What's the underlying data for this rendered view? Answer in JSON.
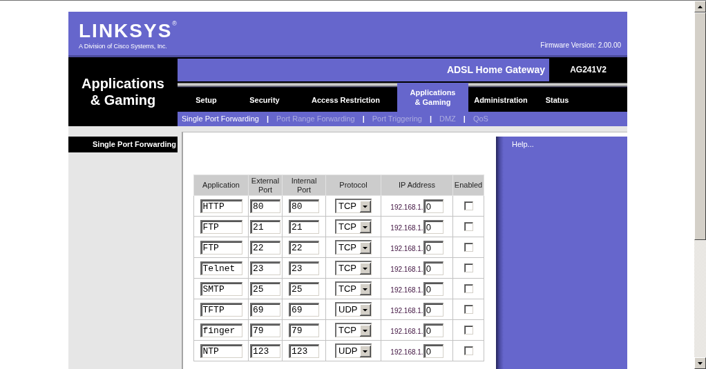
{
  "header": {
    "logo": "LINKSYS$^{®}$",
    "tagline": "A Division of Cisco Systems, Inc.",
    "firmware": "Firmware Version: 2.00.00"
  },
  "section_title": "Applications & Gaming",
  "product": {
    "name": "ADSL Home Gateway",
    "model": "AG241V2"
  },
  "tabs": [
    {
      "label": "Setup",
      "selected": false
    },
    {
      "label": "Security",
      "selected": false
    },
    {
      "label": "Access Restriction",
      "selected": false
    },
    {
      "label": "Applications & Gaming",
      "selected": true
    },
    {
      "label": "Administration",
      "selected": false
    },
    {
      "label": "Status",
      "selected": false
    }
  ],
  "subnav": [
    {
      "kind": "link",
      "label": "Single Port Forwarding",
      "selected": true
    },
    {
      "kind": "separator",
      "label": "|"
    },
    {
      "kind": "link",
      "label": "Port Range Forwarding",
      "selected": false
    },
    {
      "kind": "separator",
      "label": "|"
    },
    {
      "kind": "link",
      "label": "Port Triggering",
      "selected": false
    },
    {
      "kind": "separator",
      "label": "|"
    },
    {
      "kind": "link",
      "label": "DMZ",
      "selected": false
    },
    {
      "kind": "separator",
      "label": "|"
    },
    {
      "kind": "link",
      "label": "QoS",
      "selected": false
    }
  ],
  "sidebar": {
    "heading": "Single Port Forwarding"
  },
  "table": {
    "columns": [
      "Application",
      "External Port",
      "Internal Port",
      "Protocol",
      "IP Address",
      "Enabled"
    ],
    "rows": [
      {
        "application": "HTTP",
        "external_port": "80",
        "internal_port": "80",
        "protocol": "TCP",
        "ip_prefix": "192.168.1.",
        "ip_last": "0",
        "enabled": false
      },
      {
        "application": "FTP",
        "external_port": "21",
        "internal_port": "21",
        "protocol": "TCP",
        "ip_prefix": "192.168.1.",
        "ip_last": "0",
        "enabled": false
      },
      {
        "application": "FTP",
        "external_port": "22",
        "internal_port": "22",
        "protocol": "TCP",
        "ip_prefix": "192.168.1.",
        "ip_last": "0",
        "enabled": false
      },
      {
        "application": "Telnet",
        "external_port": "23",
        "internal_port": "23",
        "protocol": "TCP",
        "ip_prefix": "192.168.1.",
        "ip_last": "0",
        "enabled": false
      },
      {
        "application": "SMTP",
        "external_port": "25",
        "internal_port": "25",
        "protocol": "TCP",
        "ip_prefix": "192.168.1.",
        "ip_last": "0",
        "enabled": false
      },
      {
        "application": "TFTP",
        "external_port": "69",
        "internal_port": "69",
        "protocol": "UDP",
        "ip_prefix": "192.168.1.",
        "ip_last": "0",
        "enabled": false
      },
      {
        "application": "finger",
        "external_port": "79",
        "internal_port": "79",
        "protocol": "TCP",
        "ip_prefix": "192.168.1.",
        "ip_last": "0",
        "enabled": false
      },
      {
        "application": "NTP",
        "external_port": "123",
        "internal_port": "123",
        "protocol": "UDP",
        "ip_prefix": "192.168.1.",
        "ip_last": "0",
        "enabled": false
      }
    ]
  },
  "help": {
    "link": "Help..."
  }
}
